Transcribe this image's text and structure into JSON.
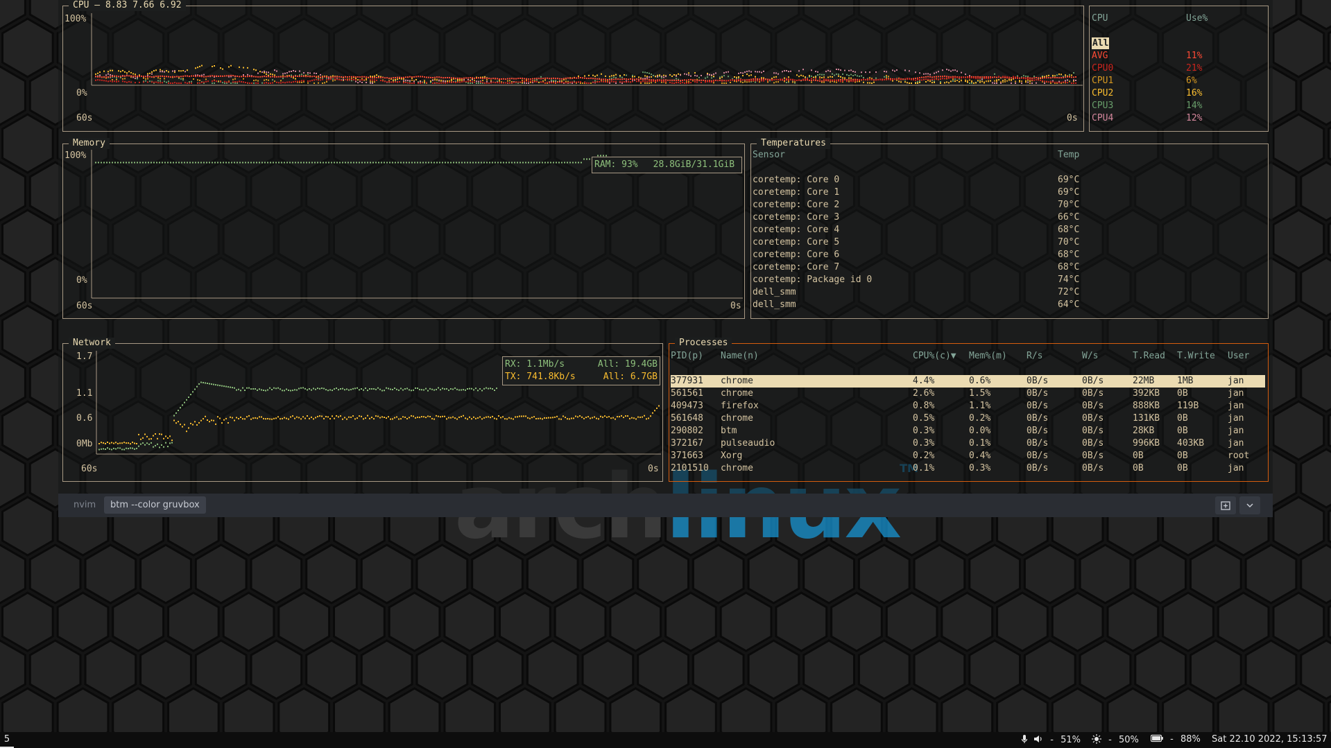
{
  "colors": {
    "fg": "#d5c4a1",
    "border": "#a89984",
    "selected_border": "#d65d0e",
    "avg": "#fb4934",
    "cpu0": "#cc241d",
    "cpu1": "#d79921",
    "cpu2": "#fabd2f",
    "cpu3": "#689d6a",
    "cpu4": "#d3869b",
    "ram": "#8ec07c",
    "tx": "#fabd2f",
    "rx": "#8ec07c"
  },
  "wallpaper": {
    "logo_gray": "arch",
    "logo_blue": "linux",
    "tm": "TM"
  },
  "cpu": {
    "title": "CPU — 8.83 7.66 6.92",
    "y_top": "100%",
    "y_bottom": "0%",
    "x_left": "60s",
    "x_right": "0s",
    "legend_header_cpu": "CPU",
    "legend_header_use": "Use%",
    "selected": "All",
    "rows": [
      {
        "name": "AVG",
        "use": "11%",
        "color": "#fb4934"
      },
      {
        "name": "CPU0",
        "use": "21%",
        "color": "#cc241d"
      },
      {
        "name": "CPU1",
        "use": "6%",
        "color": "#d79921"
      },
      {
        "name": "CPU2",
        "use": "16%",
        "color": "#fabd2f"
      },
      {
        "name": "CPU3",
        "use": "14%",
        "color": "#689d6a"
      },
      {
        "name": "CPU4",
        "use": "12%",
        "color": "#d3869b"
      }
    ]
  },
  "memory": {
    "title": "Memory",
    "y_top": "100%",
    "y_bottom": "0%",
    "x_left": "60s",
    "x_right": "0s",
    "ram_label": "RAM: 93%",
    "ram_value": "28.8GiB/31.1GiB",
    "ram_fraction": 0.93
  },
  "temperatures": {
    "title": "Temperatures",
    "col_sensor": "Sensor",
    "col_temp": "Temp",
    "rows": [
      [
        "coretemp: Core 0",
        "69°C"
      ],
      [
        "coretemp: Core 1",
        "69°C"
      ],
      [
        "coretemp: Core 2",
        "70°C"
      ],
      [
        "coretemp: Core 3",
        "66°C"
      ],
      [
        "coretemp: Core 4",
        "68°C"
      ],
      [
        "coretemp: Core 5",
        "70°C"
      ],
      [
        "coretemp: Core 6",
        "68°C"
      ],
      [
        "coretemp: Core 7",
        "68°C"
      ],
      [
        "coretemp: Package id 0",
        "74°C"
      ],
      [
        "dell_smm",
        "72°C"
      ],
      [
        "dell_smm",
        "64°C"
      ]
    ]
  },
  "network": {
    "title": "Network",
    "y_labels": [
      "1.7",
      "1.1",
      "0.6",
      "0Mb"
    ],
    "x_left": "60s",
    "x_right": "0s",
    "rx": "RX: 1.1Mb/s",
    "rx_all": "All: 19.4GB",
    "tx": "TX: 741.8Kb/s",
    "tx_all": "All: 6.7GB"
  },
  "processes": {
    "title": "Processes",
    "headers": [
      "PID(p)",
      "Name(n)",
      "CPU%(c)▼",
      "Mem%(m)",
      "R/s",
      "W/s",
      "T.Read",
      "T.Write",
      "User"
    ],
    "rows": [
      [
        "377931",
        "chrome",
        "4.4%",
        "0.6%",
        "0B/s",
        "0B/s",
        "22MB",
        "1MB",
        "jan"
      ],
      [
        "561561",
        "chrome",
        "2.6%",
        "1.5%",
        "0B/s",
        "0B/s",
        "392KB",
        "0B",
        "jan"
      ],
      [
        "409473",
        "firefox",
        "0.8%",
        "1.1%",
        "0B/s",
        "0B/s",
        "888KB",
        "119B",
        "jan"
      ],
      [
        "561648",
        "chrome",
        "0.5%",
        "0.2%",
        "0B/s",
        "0B/s",
        "131KB",
        "0B",
        "jan"
      ],
      [
        "290802",
        "btm",
        "0.3%",
        "0.0%",
        "0B/s",
        "0B/s",
        "28KB",
        "0B",
        "jan"
      ],
      [
        "372167",
        "pulseaudio",
        "0.3%",
        "0.1%",
        "0B/s",
        "0B/s",
        "996KB",
        "403KB",
        "jan"
      ],
      [
        "371663",
        "Xorg",
        "0.2%",
        "0.4%",
        "0B/s",
        "0B/s",
        "0B",
        "0B",
        "root"
      ],
      [
        "2101510",
        "chrome",
        "0.1%",
        "0.3%",
        "0B/s",
        "0B/s",
        "0B",
        "0B",
        "jan"
      ]
    ]
  },
  "tabs": {
    "items": [
      "nvim",
      "btm --color gruvbox"
    ],
    "active": 1,
    "add_icon": "new-tab-icon",
    "menu_icon": "chevron-down-icon"
  },
  "statusbar": {
    "workspace": "5",
    "volume_icon": "volume-icon",
    "mic_icon": "microphone-icon",
    "volume": "51%",
    "brightness_icon": "brightness-icon",
    "brightness": "50%",
    "battery_icon": "battery-icon",
    "battery": "88%",
    "datetime": "Sat 22.10 2022, 15:13:57"
  }
}
